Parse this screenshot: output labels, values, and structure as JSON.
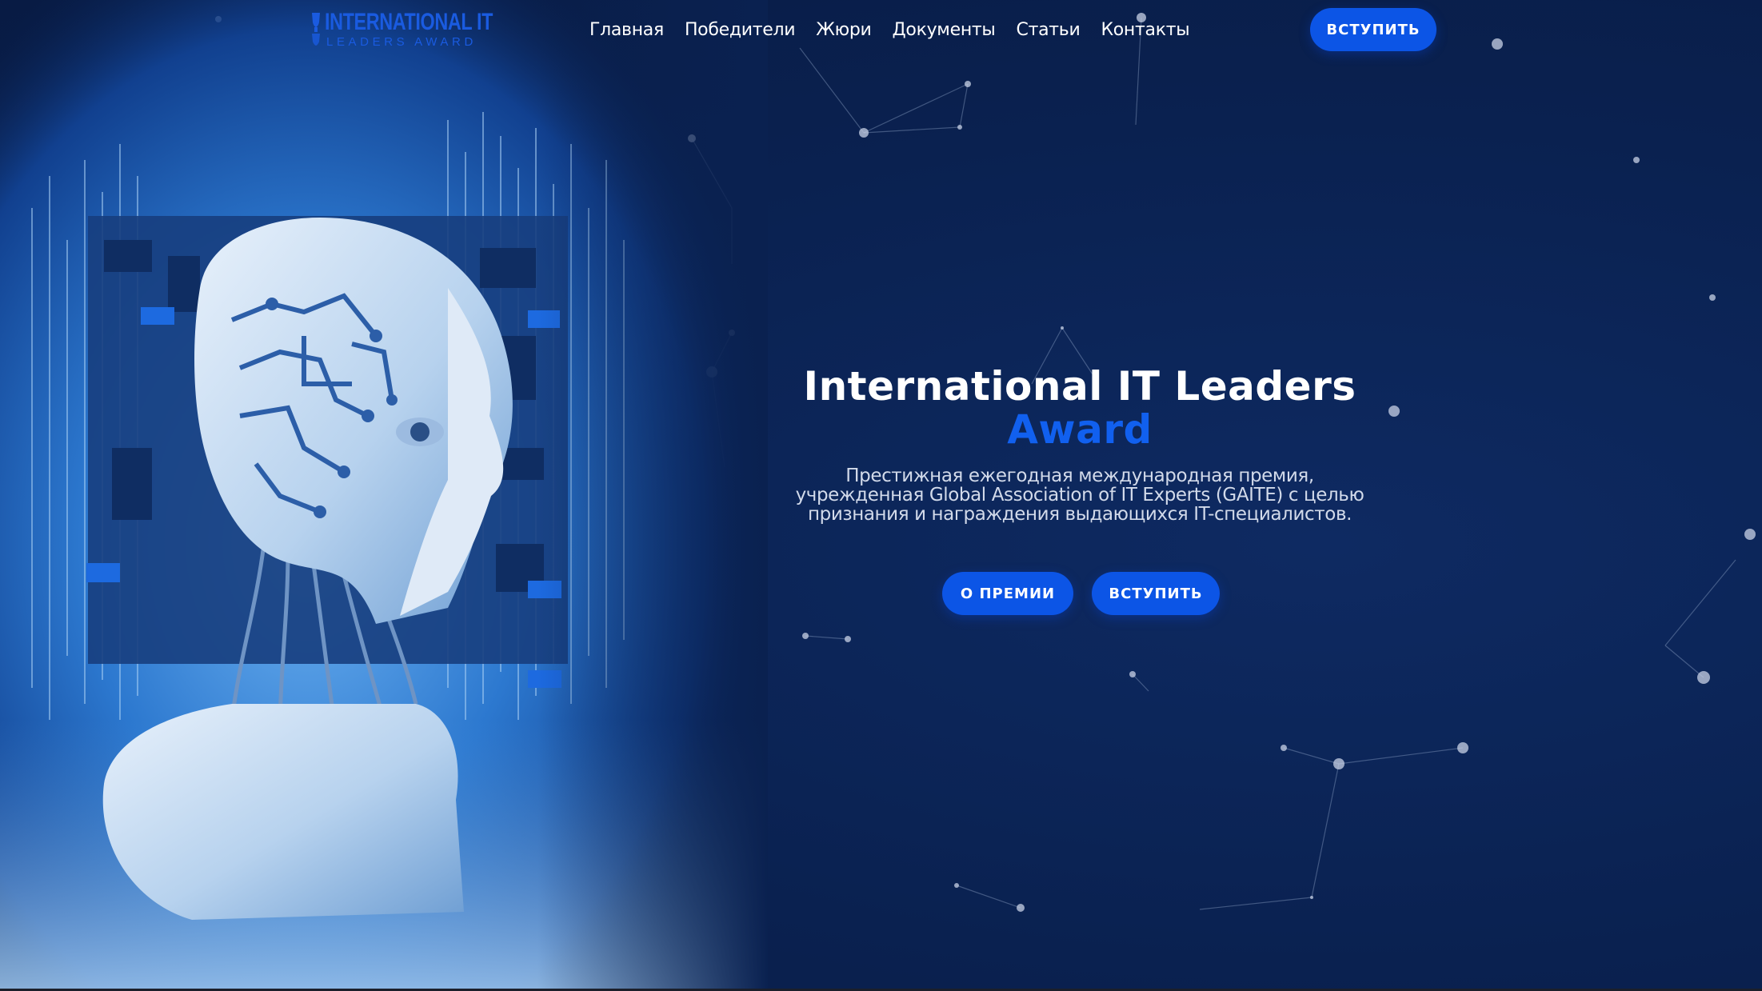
{
  "logo": {
    "line1": "INTERNATIONAL IT",
    "line2": "LEADERS AWARD"
  },
  "nav": {
    "items": [
      "Главная",
      "Победители",
      "Жюри",
      "Документы",
      "Статьи",
      "Контакты"
    ]
  },
  "header": {
    "cta_label": "ВСТУПИТЬ"
  },
  "hero": {
    "title_line1": "International IT Leaders",
    "title_line2": "Award",
    "subtitle": "Престижная ежегодная международная премия, учрежденная Global Association of IT Experts (GAITE) с целью признания и награждения выдающихся IT-специалистов.",
    "about_button": "О ПРЕМИИ",
    "join_button": "ВСТУПИТЬ"
  },
  "colors": {
    "background": "#0b2150",
    "accent": "#0c55e6",
    "title_accent": "#1160ef",
    "text": "#ffffff"
  },
  "icons": [
    "logo-trophy-icon"
  ]
}
